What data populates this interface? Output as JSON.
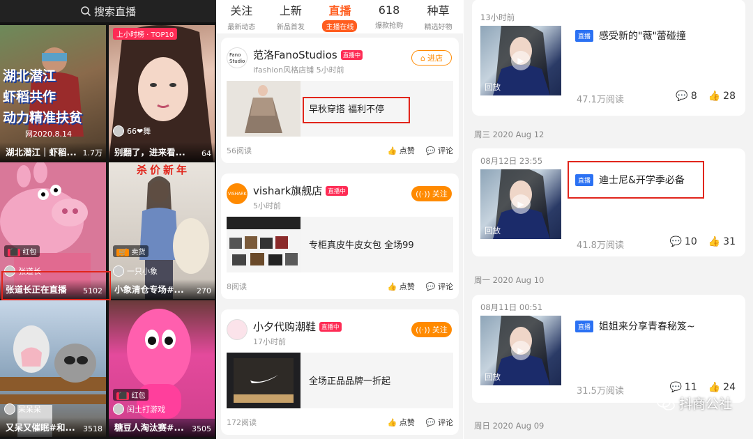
{
  "p1": {
    "search_label": "搜索直播",
    "tiles": [
      {
        "caption": "湖北潜江｜虾稻...",
        "count": "1.7万",
        "overlay": [
          "湖北潜江",
          "虾稻共作",
          "动力精准扶贫"
        ],
        "stamp": "网2020.8.14",
        "user": "",
        "badge": "",
        "badge_pre": ""
      },
      {
        "caption": "别翻了，进来看...",
        "count": "64",
        "overlay": [],
        "stamp": "",
        "user": "66❤舞",
        "badge": "上小时榜 · TOP10",
        "badge_pre": ""
      },
      {
        "caption": "张道长正在直播",
        "count": "5102",
        "overlay": [],
        "stamp": "",
        "user": "张道长",
        "badge": "红包",
        "badge_pre": ""
      },
      {
        "caption": "小象清仓专场#...",
        "count": "270",
        "overlay": [
          "杀",
          "价",
          "新",
          "年"
        ],
        "stamp": "",
        "user": "一只小象",
        "badge": "卖货",
        "badge_pre": ""
      },
      {
        "caption": "又呆又催眠#和...",
        "count": "3518",
        "overlay": [],
        "stamp": "",
        "user": "呆呆呆",
        "badge": "",
        "badge_pre": ""
      },
      {
        "caption": "糖豆人淘汰赛#...",
        "count": "3505",
        "overlay": [],
        "stamp": "",
        "user": "闰土打游戏",
        "badge": "红包",
        "badge_pre": ""
      }
    ]
  },
  "p2": {
    "tabs": [
      {
        "title": "关注",
        "sub": "最新动态"
      },
      {
        "title": "上新",
        "sub": "新品首发"
      },
      {
        "title": "直播",
        "sub": "主播在线"
      },
      {
        "title": "618",
        "sub": "爆款抢购"
      },
      {
        "title": "种草",
        "sub": "精选好物"
      }
    ],
    "cards": [
      {
        "name": "范洛FanoStudios",
        "live": "直播中",
        "sub": "ifashion风格店铺    5小时前",
        "action": "进店",
        "box_text": "早秋穿搭 福利不停",
        "reads": "56阅读",
        "like": "点赞",
        "comment": "评论",
        "logo": "Fano Studio"
      },
      {
        "name": "vishark旗舰店",
        "live": "直播中",
        "sub": "5小时前",
        "action": "关注",
        "box_text": "专柜真皮牛皮女包 全场99",
        "reads": "8阅读",
        "like": "点赞",
        "comment": "评论",
        "logo": "VISHARK"
      },
      {
        "name": "小夕代购潮鞋",
        "live": "直播中",
        "sub": "17小时前",
        "action": "关注",
        "box_text": "全场正品品牌一折起",
        "reads": "172阅读",
        "like": "点赞",
        "comment": "评论",
        "logo": ""
      }
    ]
  },
  "p3": {
    "dates": [
      "周三 2020 Aug 12",
      "周一 2020 Aug 10",
      "周日 2020 Aug 09"
    ],
    "posts": [
      {
        "time": "13小时前",
        "tag": "直播",
        "title": "感受新的\"薇\"蕾碰撞",
        "replay": "回放",
        "reads": "47.1万阅读",
        "comments": "8",
        "likes": "28"
      },
      {
        "time": "08月12日 23:55",
        "tag": "直播",
        "title": "迪士尼&开学季必备",
        "replay": "回放",
        "reads": "41.8万阅读",
        "comments": "10",
        "likes": "31"
      },
      {
        "time": "08月11日 00:51",
        "tag": "直播",
        "title": "姐姐来分享青春秘笈~",
        "replay": "回放",
        "reads": "31.5万阅读",
        "comments": "11",
        "likes": "24"
      }
    ],
    "watermark": "抖商公社"
  },
  "colors": {
    "accent_orange": "#ff5d1f",
    "live_red": "#fe2c55",
    "tag_blue": "#2b71f3",
    "highlight_red": "#e1251b"
  }
}
